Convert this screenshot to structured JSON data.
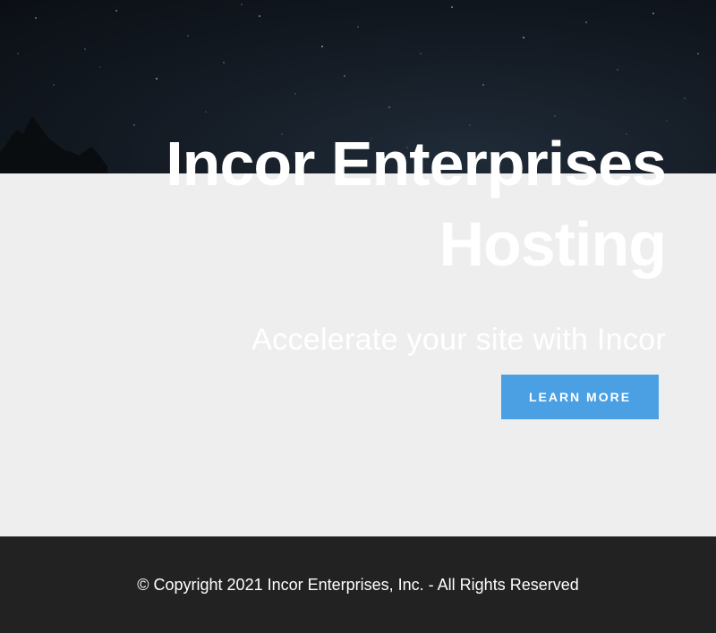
{
  "hero": {
    "title_line1": "Incor Enterprises",
    "title_line2": "Hosting",
    "subtitle": "Accelerate your site with Incor",
    "button_label": "LEARN MORE",
    "background_icon": "night-sky-stars-image"
  },
  "footer": {
    "copyright": "© Copyright 2021 Incor Enterprises, Inc. - All Rights Reserved"
  },
  "colors": {
    "accent": "#4aa0e3",
    "footer_bg": "#222222",
    "page_bg": "#eeeeee",
    "hero_bg": "#111820"
  }
}
